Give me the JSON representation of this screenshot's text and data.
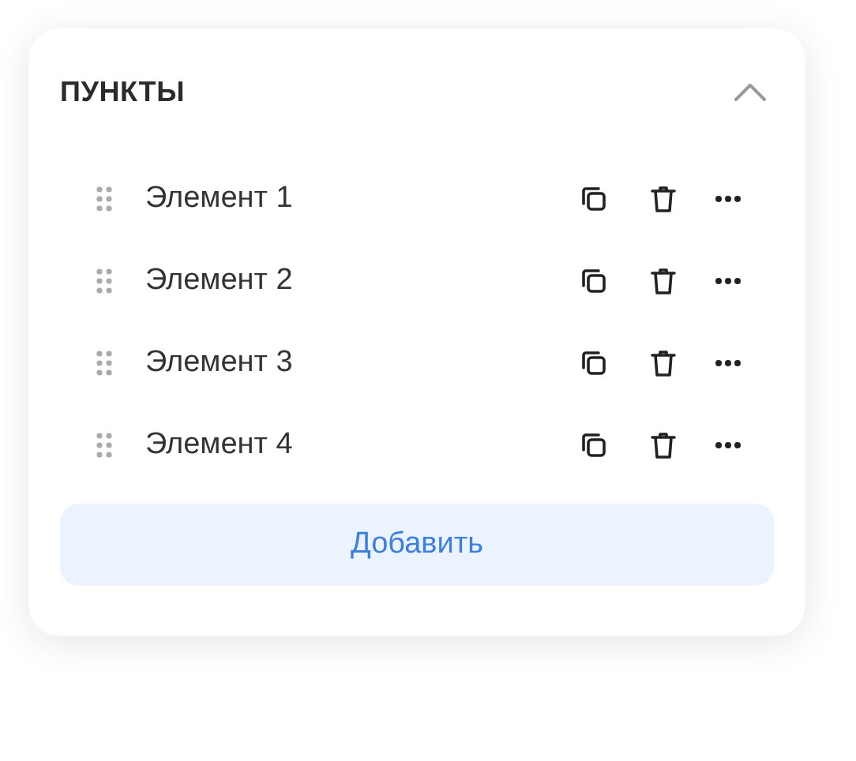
{
  "section": {
    "title": "ПУНКТЫ",
    "expanded": true
  },
  "items": [
    {
      "label": "Элемент 1"
    },
    {
      "label": "Элемент 2"
    },
    {
      "label": "Элемент 3"
    },
    {
      "label": "Элемент 4"
    }
  ],
  "add_button": "Добавить"
}
